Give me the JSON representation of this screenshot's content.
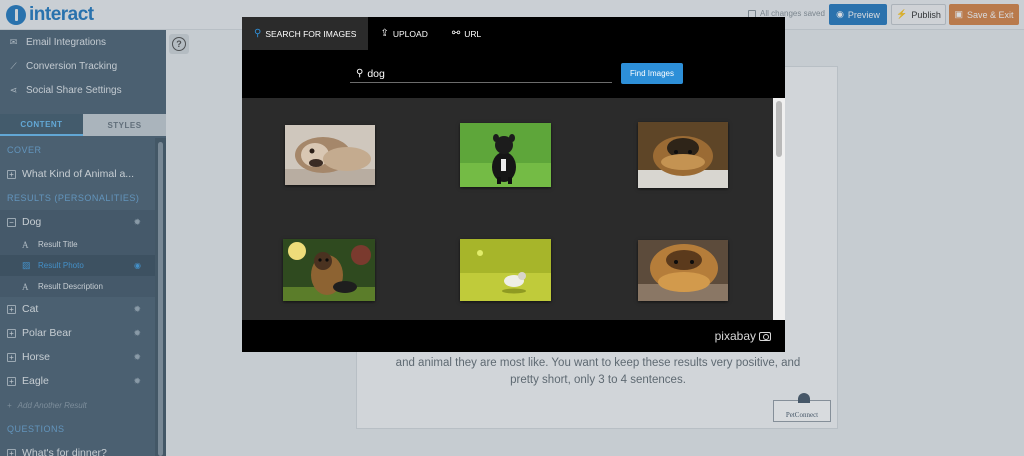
{
  "app": {
    "logo_text": "interact"
  },
  "header": {
    "saved_status": "All changes saved",
    "preview_label": "Preview",
    "publish_label": "Publish",
    "save_exit_label": "Save & Exit"
  },
  "sidebar": {
    "links": [
      {
        "label": "Email Integrations",
        "icon": "envelope-icon"
      },
      {
        "label": "Conversion Tracking",
        "icon": "chart-icon"
      },
      {
        "label": "Social Share Settings",
        "icon": "share-icon"
      }
    ],
    "tabs": {
      "content": "CONTENT",
      "styles": "STYLES"
    },
    "cover_heading": "COVER",
    "cover_item": "What Kind of Animal a...",
    "results_heading": "RESULTS (PERSONALITIES)",
    "results": [
      "Dog",
      "Cat",
      "Polar Bear",
      "Horse",
      "Eagle"
    ],
    "dog_children": [
      "Result Title",
      "Result Photo",
      "Result Description"
    ],
    "add_result": "Add Another Result",
    "questions_heading": "QUESTIONS",
    "question_item": "What's for dinner?"
  },
  "canvas": {
    "description": "and animal they are most like. You want to keep these results very positive, and pretty short, only 3 to 4 sentences.",
    "logo_text": "PetConnect"
  },
  "modal": {
    "tabs": [
      "SEARCH FOR IMAGES",
      "UPLOAD",
      "URL"
    ],
    "search_value": "dog",
    "find_label": "Find Images",
    "provider": "pixabay",
    "results_count_visible": 6
  }
}
